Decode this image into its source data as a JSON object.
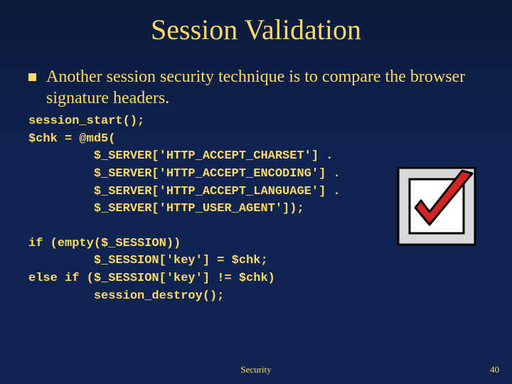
{
  "title": "Session Validation",
  "bullet": {
    "text": "Another session security technique is to compare the browser signature headers."
  },
  "code": {
    "block1": "session_start();\n$chk = @md5(\n         $_SERVER['HTTP_ACCEPT_CHARSET'] .\n         $_SERVER['HTTP_ACCEPT_ENCODING'] .\n         $_SERVER['HTTP_ACCEPT_LANGUAGE'] .\n         $_SERVER['HTTP_USER_AGENT']);",
    "block2": "if (empty($_SESSION))\n         $_SESSION['key'] = $chk;\nelse if ($_SESSION['key'] != $chk)\n         session_destroy();"
  },
  "footer": {
    "label": "Security",
    "page": "40"
  },
  "icons": {
    "checkmark": "checkmark-icon"
  }
}
